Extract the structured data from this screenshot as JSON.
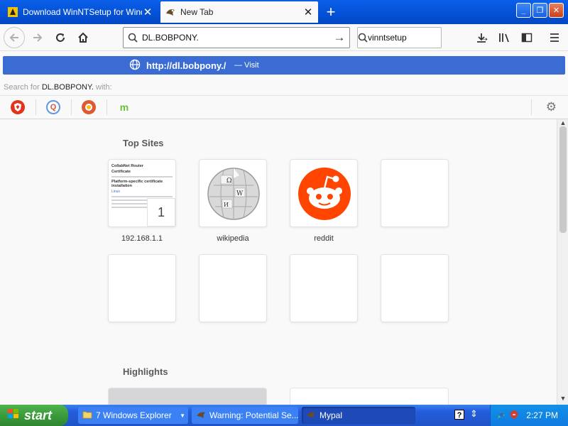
{
  "tabs": [
    {
      "title": "Download WinNTSetup for Windows",
      "active": false
    },
    {
      "title": "New Tab",
      "active": true
    }
  ],
  "window_buttons": {
    "minimize": "_",
    "maximize": "❐",
    "close": "✕"
  },
  "urlbar": {
    "value": "DL.BOBPONY."
  },
  "searchbar": {
    "value": "vinntsetup"
  },
  "suggestion": {
    "url": "http://dl.bobpony./",
    "action": "— Visit"
  },
  "search_for": {
    "prefix": "Search for",
    "query": "DL.BOBPONY.",
    "suffix": "with:"
  },
  "search_engines": [
    {
      "name": "brave-icon",
      "color": "#e2341d",
      "glyph": "◆"
    },
    {
      "name": "qwant-icon",
      "color": "#5c97e8",
      "glyph": "Q"
    },
    {
      "name": "duckduckgo-icon",
      "color": "#de5833",
      "glyph": "●"
    },
    {
      "name": "mojeek-icon",
      "color": "#6fbf3a",
      "glyph": "m"
    }
  ],
  "top_sites": {
    "heading": "Top Sites",
    "tiles": [
      {
        "label": "192.168.1.1",
        "badge": "1"
      },
      {
        "label": "wikipedia"
      },
      {
        "label": "reddit"
      },
      {
        "label": ""
      }
    ]
  },
  "router_thumb": {
    "lines": [
      "CollabNet Router",
      "Certificate",
      "Platform-specific certificate installation",
      "Linux"
    ]
  },
  "wiki_glyphs": "Ω W 維",
  "highlights": {
    "heading": "Highlights"
  },
  "taskbar": {
    "start": "start",
    "tasks": [
      {
        "label": "7 Windows Explorer"
      },
      {
        "label": "Warning: Potential Se..."
      },
      {
        "label": "Mypal"
      }
    ],
    "clock": "2:27 PM"
  },
  "colors": {
    "titlebar": "#0a5fe8",
    "suggest_highlight": "#3b6cd4",
    "reddit": "#ff4500",
    "taskbar": "#245edb",
    "start_green": "#3a9c3a"
  }
}
